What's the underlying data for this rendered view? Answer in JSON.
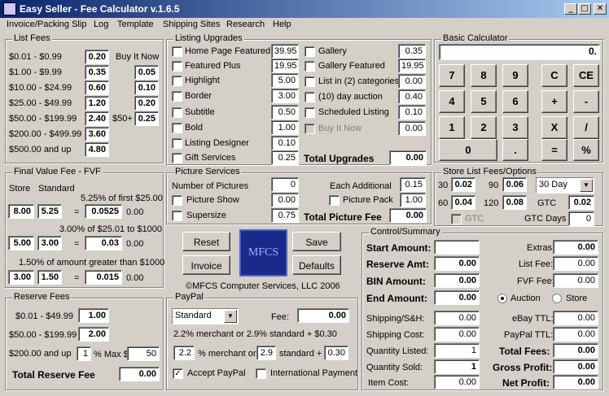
{
  "title": "Easy Seller - Fee Calculator v.1.6.5",
  "window_buttons": {
    "min": "_",
    "max": "□",
    "close": "✕"
  },
  "menu": [
    "Invoice/Packing Slip",
    "Log",
    "Template",
    "Shipping Sites",
    "Research",
    "Help"
  ],
  "list_fees": {
    "label": "List Fees",
    "buy_it_now_label": "Buy It Now",
    "rows": [
      {
        "range": "$0.01 - $0.99",
        "fee": "0.20"
      },
      {
        "range": "$1.00 - $9.99",
        "fee": "0.35",
        "bin": "0.05"
      },
      {
        "range": "$10.00 - $24.99",
        "fee": "0.60",
        "bin": "0.10"
      },
      {
        "range": "$25.00 - $49.99",
        "fee": "1.20",
        "bin": "0.20"
      },
      {
        "range": "$50.00 - $199.99",
        "fee": "2.40",
        "bin": "0.25",
        "bin_label": "$50+"
      },
      {
        "range": "$200.00 - $499.99",
        "fee": "3.60"
      },
      {
        "range": "$500.00 and up",
        "fee": "4.80"
      }
    ]
  },
  "listing_upgrades": {
    "label": "Listing Upgrades",
    "left": [
      {
        "name": "Home Page Featured",
        "value": "39.95"
      },
      {
        "name": "Featured Plus",
        "value": "19.95"
      },
      {
        "name": "Highlight",
        "value": "5.00"
      },
      {
        "name": "Border",
        "value": "3.00"
      },
      {
        "name": "Subtitle",
        "value": "0.50"
      },
      {
        "name": "Bold",
        "value": "1.00"
      },
      {
        "name": "Listing Designer",
        "value": "0.10"
      },
      {
        "name": "Gift Services",
        "value": "0.25"
      }
    ],
    "right": [
      {
        "name": "Gallery",
        "value": "0.35"
      },
      {
        "name": "Gallery Featured",
        "value": "19.95"
      },
      {
        "name": "List in (2) categories",
        "value": "0.00"
      },
      {
        "name": "(10) day auction",
        "value": "0.40"
      },
      {
        "name": "Scheduled Listing",
        "value": "0.10"
      },
      {
        "name": "Buy It Now",
        "value": "0.00",
        "disabled": true
      }
    ],
    "total_label": "Total Upgrades",
    "total": "0.00"
  },
  "basic_calculator": {
    "label": "Basic Calculator",
    "display": "0.",
    "keys": [
      [
        "7",
        "8",
        "9",
        "C",
        "CE"
      ],
      [
        "4",
        "5",
        "6",
        "+",
        "-"
      ],
      [
        "1",
        "2",
        "3",
        "X",
        "/"
      ],
      [
        "0",
        ".",
        "=",
        "%"
      ]
    ]
  },
  "fvf": {
    "label": "Final Value Fee - FVF",
    "store_label": "Store",
    "standard_label": "Standard",
    "tier1": {
      "desc": "5.25% of first $25.00",
      "store": "8.00",
      "standard": "5.25",
      "eq": "=",
      "result": "0.0525",
      "amount": "0.00"
    },
    "tier2": {
      "desc": "3.00% of $25.01 to $1000",
      "store": "5.00",
      "standard": "3.00",
      "eq": "=",
      "result": "0.03",
      "amount": "0.00"
    },
    "tier3": {
      "desc": "1.50% of amount greater than $1000",
      "store": "3.00",
      "standard": "1.50",
      "eq": "=",
      "result": "0.015",
      "amount": "0.00"
    }
  },
  "picture_services": {
    "label": "Picture Services",
    "num_pictures_label": "Number of Pictures",
    "num_pictures": "0",
    "each_additional_label": "Each Additional",
    "each_additional": "0.15",
    "picture_show_label": "Picture Show",
    "picture_show": "0.00",
    "picture_pack_label": "Picture Pack",
    "picture_pack": "1.00",
    "supersize_label": "Supersize",
    "supersize": "0.75",
    "total_label": "Total Picture Fee",
    "total": "0.00"
  },
  "store_list": {
    "label": "Store List Fees/Options",
    "d30_label": "30",
    "d30": "0.02",
    "d90_label": "90",
    "d90": "0.06",
    "d60_label": "60",
    "d60": "0.04",
    "d120_label": "120",
    "d120": "0.08",
    "duration": "30 Day",
    "gtc_label": "GTC",
    "gtc": "0.02",
    "gtc_check_label": "GTC",
    "gtc_days_label": "GTC Days",
    "gtc_days": "0"
  },
  "buttons": {
    "reset": "Reset",
    "save": "Save",
    "invoice": "Invoice",
    "defaults": "Defaults"
  },
  "logo_text": "MFCS",
  "copyright": "©MFCS Computer Services, LLC 2006",
  "reserve_fees": {
    "label": "Reserve Fees",
    "r1_label": "$0.01 - $49.99",
    "r1": "1.00",
    "r2_label": "$50.00 - $199.99",
    "r2": "2.00",
    "r3_label": "$200.00 and up",
    "r3_pct": "1",
    "r3_max_label": "% Max $",
    "r3_max": "50",
    "total_label": "Total Reserve Fee",
    "total": "0.00"
  },
  "paypal": {
    "label": "PayPal",
    "type": "Standard",
    "fee_label": "Fee:",
    "fee": "0.00",
    "rates_text": "2.2% merchant or 2.9% standard + $0.30",
    "merchant_pct": "2.2",
    "merchant_label": "% merchant or",
    "standard_pct": "2.9",
    "standard_label": "standard +",
    "flat": "0.30",
    "accept_label": "Accept PayPal",
    "intl_label": "International Payment"
  },
  "summary": {
    "label": "Control/Summary",
    "start_amount_label": "Start Amount:",
    "start_amount": "",
    "reserve_label": "Reserve Amt:",
    "reserve": "0.00",
    "bin_label": "BIN Amount:",
    "bin": "0.00",
    "end_label": "End Amount:",
    "end": "0.00",
    "extras_label": "Extras:",
    "extras": "0.00",
    "list_fee_label": "List Fee:",
    "list_fee": "0.00",
    "fvf_label": "FVF Fee:",
    "fvf": "0.00",
    "auction_label": "Auction",
    "store_label": "Store",
    "shipping_label": "Shipping/S&H:",
    "shipping": "0.00",
    "ship_cost_label": "Shipping Cost:",
    "ship_cost": "0.00",
    "qty_listed_label": "Quantity Listed:",
    "qty_listed": "1",
    "qty_sold_label": "Quantity Sold:",
    "qty_sold": "1",
    "item_cost_label": "Item Cost:",
    "item_cost": "0.00",
    "ebay_ttl_label": "eBay TTL:",
    "ebay_ttl": "0.00",
    "paypal_ttl_label": "PayPal TTL:",
    "paypal_ttl": "0.00",
    "total_fees_label": "Total Fees:",
    "total_fees": "0.00",
    "gross_label": "Gross Profit:",
    "gross": "0.00",
    "net_label": "Net Profit:",
    "net": "0.00"
  }
}
